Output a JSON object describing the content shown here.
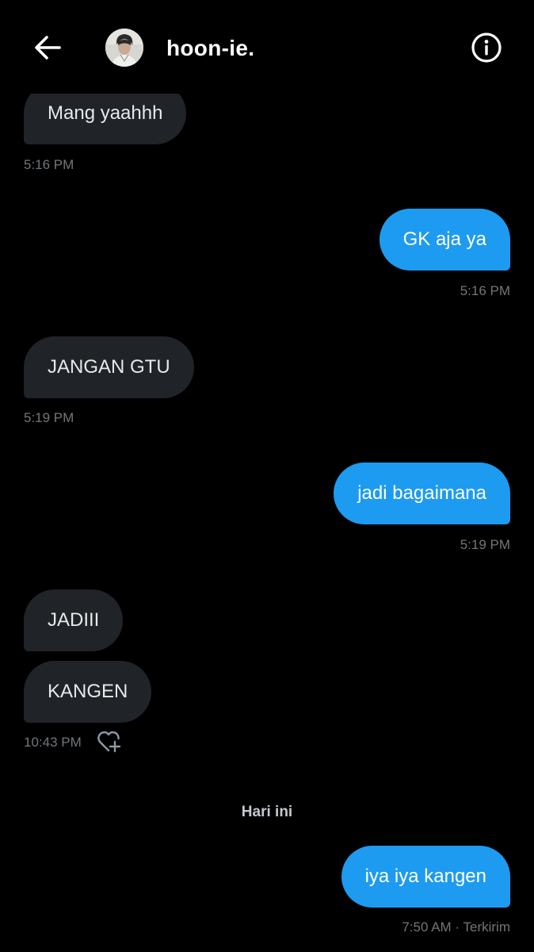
{
  "header": {
    "username": "hoon-ie."
  },
  "icons": {
    "back": "arrow-left-icon",
    "info": "info-circle-icon",
    "like": "heart-plus-icon"
  },
  "colors": {
    "background": "#000000",
    "incoming_bubble": "#202327",
    "outgoing_bubble": "#1d9bf0",
    "timestamp": "#71767b"
  },
  "messages": [
    {
      "direction": "incoming",
      "text": "Mang yaahhh",
      "time": "5:16 PM"
    },
    {
      "direction": "outgoing",
      "text": "GK aja ya",
      "time": "5:16 PM"
    },
    {
      "direction": "incoming",
      "text": "JANGAN GTU",
      "time": "5:19 PM"
    },
    {
      "direction": "outgoing",
      "text": "jadi bagaimana",
      "time": "5:19 PM"
    },
    {
      "direction": "incoming",
      "text": "JADIII"
    },
    {
      "direction": "incoming",
      "text": "KANGEN",
      "time": "10:43 PM"
    }
  ],
  "day_separator": "Hari ini",
  "today_messages": [
    {
      "direction": "outgoing",
      "text": "iya iya kangen",
      "time": "7:50 AM",
      "status": "Terkirim"
    }
  ],
  "last_status": "7:50 AM · Terkirim"
}
